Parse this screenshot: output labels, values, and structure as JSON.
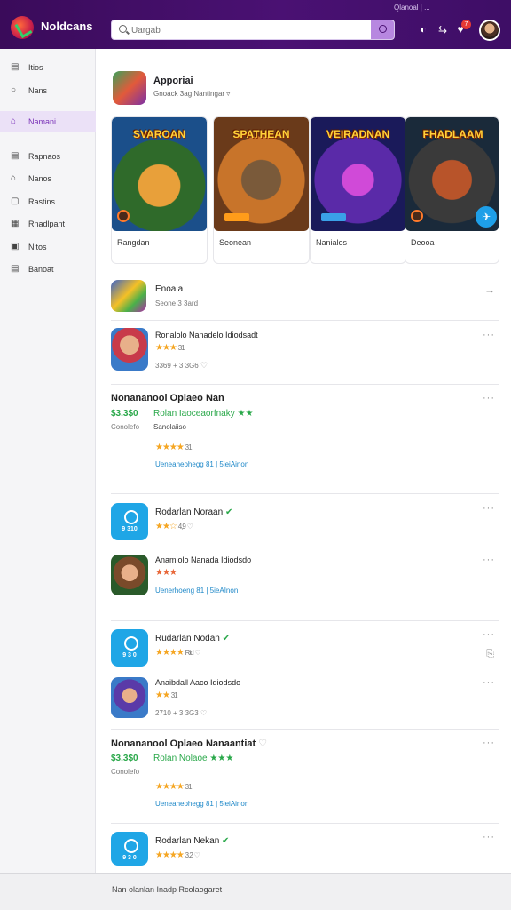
{
  "header": {
    "brand": "Noldcans",
    "brand_sub": "",
    "search_placeholder": "Uargab",
    "top_text": "Qlanoal | ...",
    "notification_count": "7"
  },
  "sidebar": {
    "items": [
      {
        "label": "Itios",
        "icon": "grid-icon"
      },
      {
        "label": "Nans",
        "icon": "search-icon"
      },
      {
        "label": "Namani",
        "icon": "home-icon",
        "active": true
      },
      {
        "label": "Rapnaos",
        "icon": "list-icon"
      },
      {
        "label": "Nanos",
        "icon": "house-icon"
      },
      {
        "label": "Rastins",
        "icon": "box-icon"
      },
      {
        "label": "Rnadlpant",
        "icon": "grid-icon"
      },
      {
        "label": "Nitos",
        "icon": "store-icon"
      },
      {
        "label": "Banoat",
        "icon": "bookmark-icon"
      }
    ]
  },
  "section": {
    "title": "Apporiai",
    "subtitle": "Gnoack 3ag Nantingar"
  },
  "featured_cards": [
    {
      "art_title": "SVAROAN",
      "label": "Rangdan"
    },
    {
      "art_title": "SPATHEAN",
      "label": "Seonean"
    },
    {
      "art_title": "VEIRADNAN",
      "label": "Nanialos"
    },
    {
      "art_title": "FHADLAAM",
      "label": "Deooa"
    }
  ],
  "list": {
    "row1": {
      "title": "Enoaia",
      "meta": "Seone 3 3ard"
    },
    "row2": {
      "title": "Ronalolo Nanadelo Idiodsadt",
      "meta": "3369 + 3 3G6"
    },
    "row3": {
      "title": "Nonananool Oplaeo Nan",
      "price": "$3.3$0",
      "green": "Rolan Iaoceaorfnaky",
      "meta": "Conolefo",
      "meta2": "Sanolaiiso",
      "link": "Ueneaheohegg 81 | 5ieiAinon"
    },
    "row4": {
      "title": "Rodarlan Noraan",
      "icon_label": "9 310",
      "rating": "4,9"
    },
    "row5": {
      "title": "Anamlolo Nanada Idiodsdo",
      "link": "Uenerhoeng 81 | 5ieAInon"
    },
    "row6": {
      "title": "Rudarlan Nodan",
      "icon_label": "9 3 0",
      "rating": "Rid"
    },
    "row7": {
      "title": "Anaibdall Aaco Idiodsdo",
      "meta": "2710 + 3 3G3"
    },
    "row8": {
      "title": "Nonananool Oplaeo Nanaantiat",
      "price": "$3.3$0",
      "green": "Rolan Nolaoe",
      "meta": "Conolefo",
      "link": "Ueneaheohegg 81 | 5ieiAinon"
    },
    "row9": {
      "title": "Rodarlan Nekan",
      "icon_label": "9 3 0",
      "rating": "3,2"
    }
  },
  "footer": {
    "text": "Nan olanlan Inadp Rcolaogaret"
  },
  "colors": {
    "header_bg": "#4a1173",
    "accent": "#7a32b8",
    "green": "#2aa84a",
    "star": "#f5a623",
    "blue": "#1fa6e6"
  }
}
